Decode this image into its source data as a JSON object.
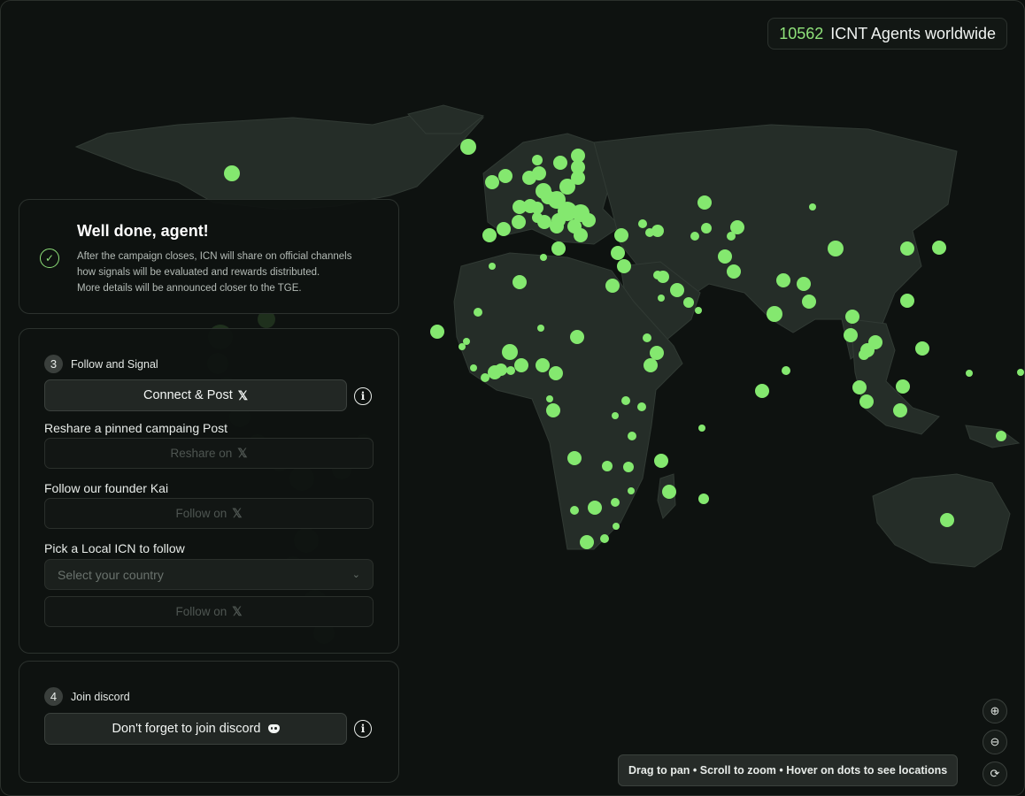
{
  "header": {
    "agent_count": "10562",
    "agent_label": "ICNT Agents worldwide"
  },
  "done_card": {
    "title": "Well done, agent!",
    "lines": [
      "After the campaign closes, ICN will share on official channels",
      "how signals will be evaluated and rewards distributed.",
      "More details will be announced closer to the TGE."
    ]
  },
  "step3": {
    "number": "3",
    "title": "Follow and Signal",
    "connect_label": "Connect & Post",
    "reshare_heading": "Reshare a pinned campaing Post",
    "reshare_label": "Reshare on",
    "founder_heading": "Follow our founder Kai",
    "follow_label": "Follow on",
    "local_heading": "Pick a Local ICN to follow",
    "country_placeholder": "Select your country",
    "local_follow_label": "Follow on"
  },
  "step4": {
    "number": "4",
    "title": "Join discord",
    "discord_label": "Don't forget to join discord"
  },
  "hint": "Drag to pan • Scroll to zoom • Hover on dots to see locations",
  "icons": {
    "x": "𝕏",
    "info": "i",
    "check": "✓",
    "zoom_in": "⊕",
    "zoom_out": "⊖",
    "refresh": "⟳"
  },
  "colors": {
    "accent": "#8fe27a",
    "dot": "#84e86f",
    "land": "#26302a",
    "background": "#0e1210"
  }
}
